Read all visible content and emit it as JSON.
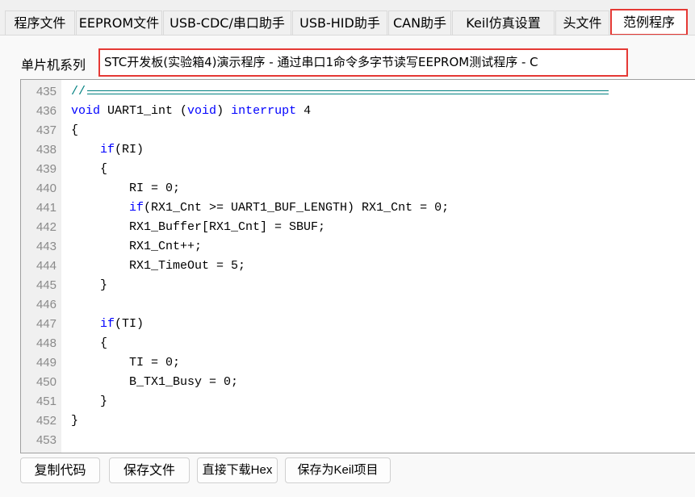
{
  "tabs": [
    {
      "label": "程序文件",
      "active": false
    },
    {
      "label": "EEPROM文件",
      "active": false
    },
    {
      "label": "USB-CDC/串口助手",
      "active": false
    },
    {
      "label": "USB-HID助手",
      "active": false
    },
    {
      "label": "CAN助手",
      "active": false
    },
    {
      "label": "Keil仿真设置",
      "active": false
    },
    {
      "label": "头文件",
      "active": false
    },
    {
      "label": "范例程序",
      "active": true
    }
  ],
  "series_label": "单片机系列",
  "selected_program": "STC开发板(实验箱4)演示程序 - 通过串口1命令多字节读写EEPROM测试程序 - C",
  "code_lines": [
    {
      "n": "435",
      "indent": 0,
      "tokens": [
        {
          "t": "//",
          "s": "c"
        }
      ],
      "rule": true
    },
    {
      "n": "436",
      "indent": 0,
      "tokens": [
        {
          "t": "void",
          "s": "k"
        },
        {
          "t": " UART1_int (",
          "s": "n"
        },
        {
          "t": "void",
          "s": "k"
        },
        {
          "t": ") ",
          "s": "n"
        },
        {
          "t": "interrupt",
          "s": "k"
        },
        {
          "t": " 4",
          "s": "n"
        }
      ]
    },
    {
      "n": "437",
      "indent": 0,
      "tokens": [
        {
          "t": "{",
          "s": "n"
        }
      ]
    },
    {
      "n": "438",
      "indent": 1,
      "tokens": [
        {
          "t": "if",
          "s": "k"
        },
        {
          "t": "(RI)",
          "s": "n"
        }
      ]
    },
    {
      "n": "439",
      "indent": 1,
      "tokens": [
        {
          "t": "{",
          "s": "n"
        }
      ]
    },
    {
      "n": "440",
      "indent": 2,
      "tokens": [
        {
          "t": "RI = 0;",
          "s": "n"
        }
      ]
    },
    {
      "n": "441",
      "indent": 2,
      "tokens": [
        {
          "t": "if",
          "s": "k"
        },
        {
          "t": "(RX1_Cnt >= UART1_BUF_LENGTH) RX1_Cnt = 0;",
          "s": "n"
        }
      ]
    },
    {
      "n": "442",
      "indent": 2,
      "tokens": [
        {
          "t": "RX1_Buffer[RX1_Cnt] = SBUF;",
          "s": "n"
        }
      ]
    },
    {
      "n": "443",
      "indent": 2,
      "tokens": [
        {
          "t": "RX1_Cnt++;",
          "s": "n"
        }
      ]
    },
    {
      "n": "444",
      "indent": 2,
      "tokens": [
        {
          "t": "RX1_TimeOut = 5;",
          "s": "n"
        }
      ]
    },
    {
      "n": "445",
      "indent": 1,
      "tokens": [
        {
          "t": "}",
          "s": "n"
        }
      ]
    },
    {
      "n": "446",
      "indent": 0,
      "tokens": []
    },
    {
      "n": "447",
      "indent": 1,
      "tokens": [
        {
          "t": "if",
          "s": "k"
        },
        {
          "t": "(TI)",
          "s": "n"
        }
      ]
    },
    {
      "n": "448",
      "indent": 1,
      "tokens": [
        {
          "t": "{",
          "s": "n"
        }
      ]
    },
    {
      "n": "449",
      "indent": 2,
      "tokens": [
        {
          "t": "TI = 0;",
          "s": "n"
        }
      ]
    },
    {
      "n": "450",
      "indent": 2,
      "tokens": [
        {
          "t": "B_TX1_Busy = 0;",
          "s": "n"
        }
      ]
    },
    {
      "n": "451",
      "indent": 1,
      "tokens": [
        {
          "t": "}",
          "s": "n"
        }
      ]
    },
    {
      "n": "452",
      "indent": 0,
      "tokens": [
        {
          "t": "}",
          "s": "n"
        }
      ]
    },
    {
      "n": "453",
      "indent": 0,
      "tokens": []
    }
  ],
  "buttons": {
    "copy": "复制代码",
    "save": "保存文件",
    "download": "直接下载Hex",
    "save_keil": "保存为Keil项目"
  },
  "colors": {
    "keyword": "#0000ff",
    "comment": "#008080",
    "highlight": "#e53935"
  }
}
